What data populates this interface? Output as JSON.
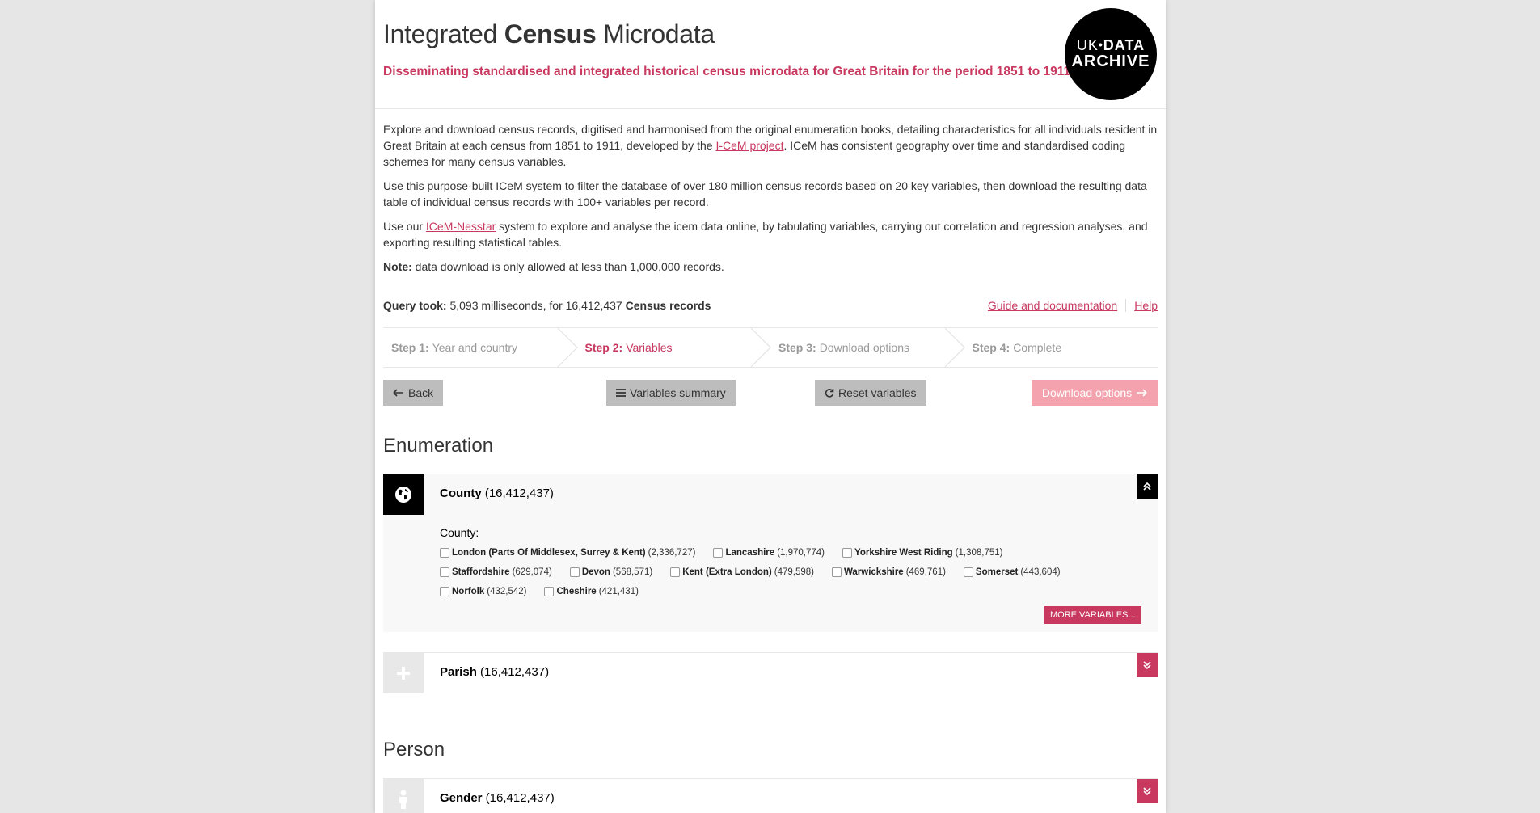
{
  "header": {
    "title_prefix": "Integrated ",
    "title_bold": "Census",
    "title_suffix": " Microdata",
    "subtitle": "Disseminating standardised and integrated historical census microdata for Great Britain for the period 1851 to 1911.",
    "logo": {
      "uk": "UK",
      "data": "DATA",
      "archive": "ARCHIVE"
    }
  },
  "intro": {
    "p1_a": "Explore and download census records, digitised and harmonised from the original enumeration books, detailing characteristics for all individuals resident in Great Britain at each census from 1851 to 1911, developed by the ",
    "p1_link": "I-CeM project",
    "p1_b": ". ICeM has consistent geography over time and standardised coding schemes for many census variables.",
    "p2": "Use this purpose-built ICeM system to filter the database of over 180 million census records based on 20 key variables, then download the resulting data table of individual census records with 100+ variables per record.",
    "p3_a": "Use our ",
    "p3_link": "ICeM-Nesstar",
    "p3_b": " system to explore and analyse the icem data online, by tabulating variables, carrying out correlation and regression analyses, and exporting resulting statistical tables.",
    "note_label": "Note:",
    "note_text": " data download is only allowed at less than 1,000,000 records."
  },
  "query": {
    "label": "Query took:",
    "text": " 5,093 milliseconds, for 16,412,437 ",
    "bold": "Census records"
  },
  "links": {
    "guide": "Guide and documentation",
    "help": "Help"
  },
  "steps": [
    {
      "num": "Step 1:",
      "label": "Year and country"
    },
    {
      "num": "Step 2:",
      "label": "Variables"
    },
    {
      "num": "Step 3:",
      "label": "Download options"
    },
    {
      "num": "Step 4:",
      "label": "Complete"
    }
  ],
  "buttons": {
    "back": "Back",
    "summary": "Variables summary",
    "reset": "Reset variables",
    "download": "Download options"
  },
  "sections": {
    "enumeration": "Enumeration",
    "person": "Person"
  },
  "county": {
    "name": "County",
    "count": " (16,412,437)",
    "label": "County:",
    "items": [
      {
        "name": "London (Parts Of Middlesex, Surrey & Kent)",
        "count": "(2,336,727)"
      },
      {
        "name": "Lancashire",
        "count": "(1,970,774)"
      },
      {
        "name": "Yorkshire West Riding",
        "count": "(1,308,751)"
      },
      {
        "name": "Staffordshire",
        "count": "(629,074)"
      },
      {
        "name": "Devon",
        "count": "(568,571)"
      },
      {
        "name": "Kent (Extra London)",
        "count": "(479,598)"
      },
      {
        "name": "Warwickshire",
        "count": "(469,761)"
      },
      {
        "name": "Somerset",
        "count": "(443,604)"
      },
      {
        "name": "Norfolk",
        "count": "(432,542)"
      },
      {
        "name": "Cheshire",
        "count": "(421,431)"
      }
    ],
    "more": "MORE VARIABLES..."
  },
  "parish": {
    "name": "Parish",
    "count": " (16,412,437)"
  },
  "gender": {
    "name": "Gender",
    "count": " (16,412,437)"
  },
  "colors": {
    "accent": "#c8385f",
    "button_grey": "#bdbdbd",
    "download_pink": "#f4a3ae"
  }
}
